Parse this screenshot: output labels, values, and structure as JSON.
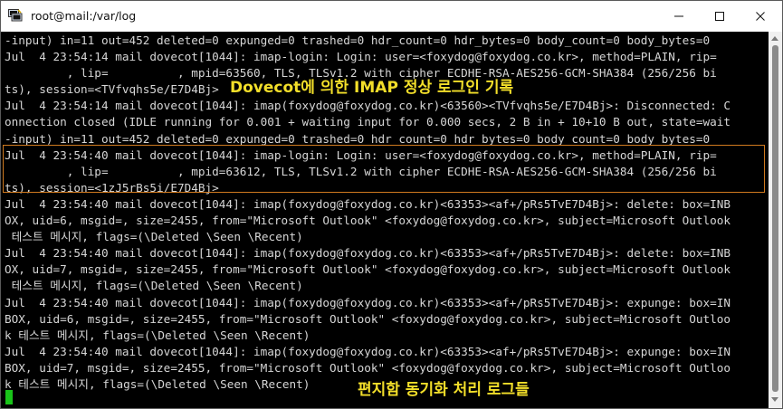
{
  "window": {
    "title": "root@mail:/var/log",
    "icon": "putty-terminal-icon"
  },
  "terminal": {
    "lines": [
      "-input) in=11 out=452 deleted=0 expunged=0 trashed=0 hdr_count=0 hdr_bytes=0 body_count=0 body_bytes=0",
      "Jul  4 23:54:14 mail dovecot[1044]: imap-login: Login: user=<foxydog@foxydog.co.kr>, method=PLAIN, rip=",
      "         , lip=          , mpid=63560, TLS, TLSv1.2 with cipher ECDHE-RSA-AES256-GCM-SHA384 (256/256 bi",
      "ts), session=<TVfvqhs5e/E7D4Bj>",
      "Jul  4 23:54:14 mail dovecot[1044]: imap(foxydog@foxydog.co.kr)<63560><TVfvqhs5e/E7D4Bj>: Disconnected: C",
      "onnection closed (IDLE running for 0.001 + waiting input for 0.000 secs, 2 B in + 10+10 B out, state=wait",
      "-input) in=11 out=452 deleted=0 expunged=0 trashed=0 hdr_count=0 hdr_bytes=0 body_count=0 body_bytes=0",
      "Jul  4 23:54:40 mail dovecot[1044]: imap-login: Login: user=<foxydog@foxydog.co.kr>, method=PLAIN, rip=",
      "         , lip=          , mpid=63612, TLS, TLSv1.2 with cipher ECDHE-RSA-AES256-GCM-SHA384 (256/256 bi",
      "ts), session=<1zJ5rBs5i/E7D4Bj>",
      "Jul  4 23:54:40 mail dovecot[1044]: imap(foxydog@foxydog.co.kr)<63353><af+/pRs5TvE7D4Bj>: delete: box=INB",
      "OX, uid=6, msgid=, size=2455, from=\"Microsoft Outlook\" <foxydog@foxydog.co.kr>, subject=Microsoft Outlook",
      " 테스트 메시지, flags=(\\Deleted \\Seen \\Recent)",
      "Jul  4 23:54:40 mail dovecot[1044]: imap(foxydog@foxydog.co.kr)<63353><af+/pRs5TvE7D4Bj>: delete: box=INB",
      "OX, uid=7, msgid=, size=2455, from=\"Microsoft Outlook\" <foxydog@foxydog.co.kr>, subject=Microsoft Outlook",
      " 테스트 메시지, flags=(\\Deleted \\Seen \\Recent)",
      "Jul  4 23:54:40 mail dovecot[1044]: imap(foxydog@foxydog.co.kr)<63353><af+/pRs5TvE7D4Bj>: expunge: box=IN",
      "BOX, uid=6, msgid=, size=2455, from=\"Microsoft Outlook\" <foxydog@foxydog.co.kr>, subject=Microsoft Outloo",
      "k 테스트 메시지, flags=(\\Deleted \\Seen \\Recent)",
      "Jul  4 23:54:40 mail dovecot[1044]: imap(foxydog@foxydog.co.kr)<63353><af+/pRs5TvE7D4Bj>: expunge: box=IN",
      "BOX, uid=7, msgid=, size=2455, from=\"Microsoft Outlook\" <foxydog@foxydog.co.kr>, subject=Microsoft Outloo",
      "k 테스트 메시지, flags=(\\Deleted \\Seen \\Recent)",
      ""
    ]
  },
  "annotations": {
    "imap_login": "Dovecot에 의한 IMAP 정상 로그인 기록",
    "folder_sync": "편지함 동기화 처리 로그들"
  },
  "colors": {
    "terminal_bg": "#000000",
    "terminal_text": "#d6d6d6",
    "annotation_text": "#f3df2a",
    "highlight_border": "#d07a1f",
    "cursor": "#19c419"
  }
}
